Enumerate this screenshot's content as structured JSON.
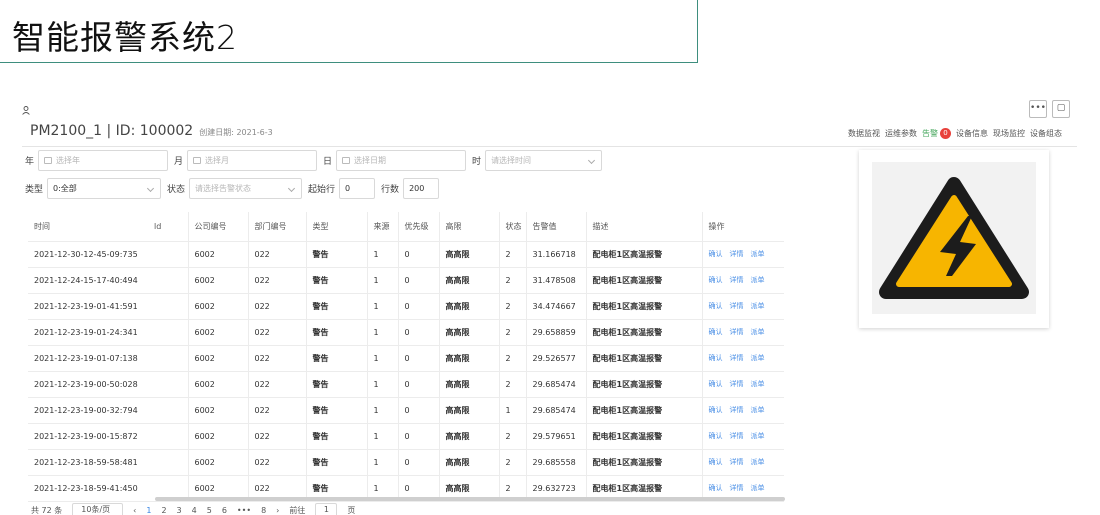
{
  "banner": {
    "title": "智能报警系统2"
  },
  "device": {
    "title": "PM2100_1 | ID: 100002",
    "created": "创建日期: 2021-6-3"
  },
  "top_buttons": {
    "more": "•••",
    "copy": "▢"
  },
  "nav": {
    "data_monitor": "数据监视",
    "ops_params": "运维参数",
    "alarm": "告警",
    "alarm_count": "0",
    "device_info": "设备信息",
    "site_monitor": "现场监控",
    "device_config": "设备组态"
  },
  "filters": {
    "year_label": "年",
    "year_placeholder": "选择年",
    "month_label": "月",
    "month_placeholder": "选择月",
    "day_label": "日",
    "day_placeholder": "选择日期",
    "time_label": "时",
    "time_placeholder": "请选择时间",
    "type_label": "类型",
    "type_value": "0:全部",
    "status_label": "状态",
    "status_placeholder": "请选择告警状态",
    "start_label": "起始行",
    "start_value": "0",
    "rows_label": "行数",
    "rows_value": "200"
  },
  "table": {
    "headers": [
      "时间",
      "ld",
      "公司编号",
      "部门编号",
      "类型",
      "来源",
      "优先级",
      "高限",
      "状态",
      "告警值",
      "描述",
      "操作"
    ],
    "ops": [
      "确认",
      "详情",
      "派单"
    ],
    "rows": [
      [
        "2021-12-30-12-45-09:735",
        "6002",
        "022",
        "警告",
        "1",
        "0",
        "高高限",
        "2",
        "31.166718",
        "配电柜1区高温报警"
      ],
      [
        "2021-12-24-15-17-40:494",
        "6002",
        "022",
        "警告",
        "1",
        "0",
        "高高限",
        "2",
        "31.478508",
        "配电柜1区高温报警"
      ],
      [
        "2021-12-23-19-01-41:591",
        "6002",
        "022",
        "警告",
        "1",
        "0",
        "高高限",
        "2",
        "34.474667",
        "配电柜1区高温报警"
      ],
      [
        "2021-12-23-19-01-24:341",
        "6002",
        "022",
        "警告",
        "1",
        "0",
        "高高限",
        "2",
        "29.658859",
        "配电柜1区高温报警"
      ],
      [
        "2021-12-23-19-01-07:138",
        "6002",
        "022",
        "警告",
        "1",
        "0",
        "高高限",
        "2",
        "29.526577",
        "配电柜1区高温报警"
      ],
      [
        "2021-12-23-19-00-50:028",
        "6002",
        "022",
        "警告",
        "1",
        "0",
        "高高限",
        "2",
        "29.685474",
        "配电柜1区高温报警"
      ],
      [
        "2021-12-23-19-00-32:794",
        "6002",
        "022",
        "警告",
        "1",
        "0",
        "高高限",
        "1",
        "29.685474",
        "配电柜1区高温报警"
      ],
      [
        "2021-12-23-19-00-15:872",
        "6002",
        "022",
        "警告",
        "1",
        "0",
        "高高限",
        "2",
        "29.579651",
        "配电柜1区高温报警"
      ],
      [
        "2021-12-23-18-59-58:481",
        "6002",
        "022",
        "警告",
        "1",
        "0",
        "高高限",
        "2",
        "29.685558",
        "配电柜1区高温报警"
      ],
      [
        "2021-12-23-18-59-41:450",
        "6002",
        "022",
        "警告",
        "1",
        "0",
        "高高限",
        "2",
        "29.632723",
        "配电柜1区高温报警"
      ]
    ]
  },
  "pager": {
    "total": "共 72 条",
    "page_size": "10条/页",
    "prev": "‹",
    "pages": [
      "1",
      "2",
      "3",
      "4",
      "5",
      "6",
      "•••",
      "8"
    ],
    "next": "›",
    "goto_label": "前往",
    "goto_value": "1",
    "goto_suffix": "页"
  },
  "colors": {
    "warning_yellow": "#f7b500",
    "accent": "#3a86e4",
    "badge": "#e8413b",
    "alarm_green": "#42a55a"
  }
}
